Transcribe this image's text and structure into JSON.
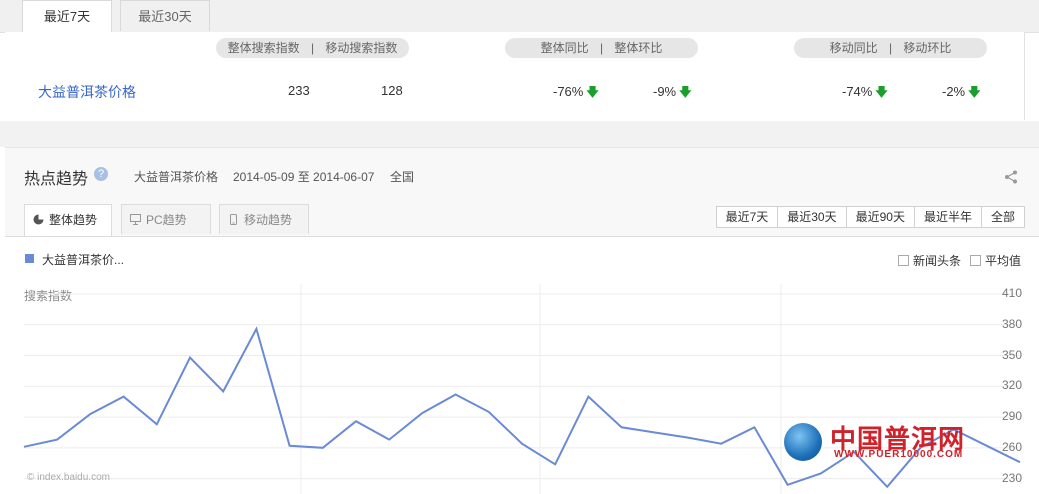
{
  "top_tabs": [
    {
      "label": "最近7天",
      "active": true
    },
    {
      "label": "最近30天",
      "active": false
    }
  ],
  "summary": {
    "header_pills": [
      {
        "left": "整体搜索指数",
        "right": "移动搜索指数"
      },
      {
        "left": "整体同比",
        "right": "整体环比"
      },
      {
        "left": "移动同比",
        "right": "移动环比"
      }
    ],
    "separator": "|",
    "keyword": "大益普洱茶价格",
    "overall_index": "233",
    "mobile_index": "128",
    "overall_yoy": "-76%",
    "overall_mom": "-9%",
    "mobile_yoy": "-74%",
    "mobile_mom": "-2%",
    "down_color": "#1a9e2c"
  },
  "trend": {
    "title": "热点趋势",
    "help_icon": "question-icon",
    "keyword": "大益普洱茶价格",
    "date_range": "2014-05-09 至 2014-06-07",
    "region": "全国",
    "share_icon": "share-icon",
    "subtabs": [
      {
        "label": "整体趋势",
        "icon": "pie-icon",
        "active": true
      },
      {
        "label": "PC趋势",
        "icon": "monitor-icon",
        "active": false
      },
      {
        "label": "移动趋势",
        "icon": "mobile-icon",
        "active": false
      }
    ],
    "range_buttons": [
      "最近7天",
      "最近30天",
      "最近90天",
      "最近半年",
      "全部"
    ],
    "legend_label": "大益普洱茶价...",
    "checkboxes": [
      "新闻头条",
      "平均值"
    ],
    "watermark": "© index.baidu.com",
    "logo_cn": "中国普洱网",
    "logo_url": "WWW.PUER10000.COM"
  },
  "chart_data": {
    "type": "line",
    "ylabel": "搜索指数",
    "ylim": [
      215,
      410
    ],
    "yticks": [
      410,
      380,
      350,
      320,
      290,
      260,
      230
    ],
    "series": [
      {
        "color": "#6a8ad6",
        "values": [
          261,
          268,
          293,
          310,
          283,
          348,
          315,
          376,
          262,
          260,
          286,
          268,
          294,
          312,
          295,
          264,
          244,
          310,
          280,
          275,
          270,
          264,
          280,
          224,
          235,
          256,
          222,
          260,
          278,
          262,
          246
        ]
      }
    ]
  }
}
